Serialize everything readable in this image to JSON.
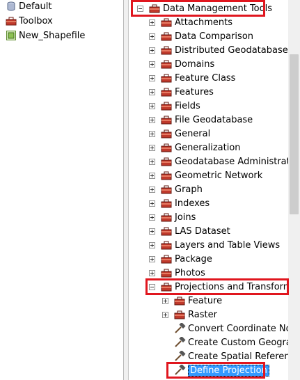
{
  "left_tree": {
    "items": [
      {
        "label": "Default",
        "icon": "database-icon"
      },
      {
        "label": "Toolbox",
        "icon": "toolbox-icon"
      },
      {
        "label": "New_Shapefile",
        "icon": "shapefile-icon"
      }
    ]
  },
  "right_tree": {
    "root": {
      "label": "Data Management Tools",
      "icon": "toolbox-icon",
      "expanded": true
    },
    "toolsets": [
      {
        "label": "Attachments"
      },
      {
        "label": "Data Comparison"
      },
      {
        "label": "Distributed Geodatabase"
      },
      {
        "label": "Domains"
      },
      {
        "label": "Feature Class"
      },
      {
        "label": "Features"
      },
      {
        "label": "Fields"
      },
      {
        "label": "File Geodatabase"
      },
      {
        "label": "General"
      },
      {
        "label": "Generalization"
      },
      {
        "label": "Geodatabase Administratio"
      },
      {
        "label": "Geometric Network"
      },
      {
        "label": "Graph"
      },
      {
        "label": "Indexes"
      },
      {
        "label": "Joins"
      },
      {
        "label": "LAS Dataset"
      },
      {
        "label": "Layers and Table Views"
      },
      {
        "label": "Package"
      },
      {
        "label": "Photos"
      }
    ],
    "projections": {
      "label": "Projections and Transforma",
      "children": [
        {
          "label": "Feature",
          "type": "toolset"
        },
        {
          "label": "Raster",
          "type": "toolset"
        },
        {
          "label": "Convert Coordinate Not",
          "type": "tool"
        },
        {
          "label": "Create Custom Geograp",
          "type": "tool"
        },
        {
          "label": "Create Spatial Reference",
          "type": "tool"
        },
        {
          "label": "Define Projection",
          "type": "tool",
          "selected": true
        }
      ]
    }
  },
  "colors": {
    "highlight_box": "#e0161e",
    "selection": "#3399ff"
  }
}
